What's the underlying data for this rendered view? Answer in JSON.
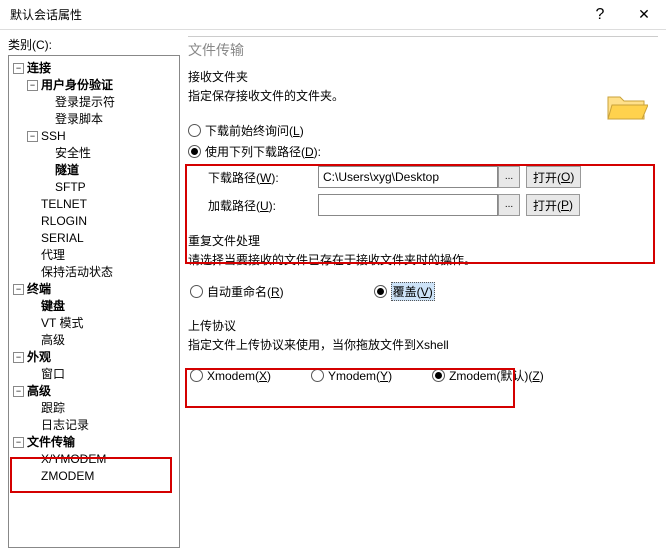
{
  "window": {
    "title": "默认会话属性",
    "help": "?",
    "close": "✕"
  },
  "left": {
    "category_label": "类别(C):"
  },
  "tree": {
    "conn": "连接",
    "auth": "用户身份验证",
    "login_prompt": "登录提示符",
    "login_script": "登录脚本",
    "ssh": "SSH",
    "security": "安全性",
    "tunnel": "隧道",
    "sftp": "SFTP",
    "telnet": "TELNET",
    "rlogin": "RLOGIN",
    "serial": "SERIAL",
    "proxy": "代理",
    "keepalive": "保持活动状态",
    "terminal": "终端",
    "keyboard": "键盘",
    "vt": "VT 模式",
    "advanced": "高级",
    "appearance": "外观",
    "window": "窗口",
    "advanced2": "高级",
    "trace": "跟踪",
    "logging": "日志记录",
    "filexfer": "文件传输",
    "xymodem": "X/YMODEM",
    "zmodem": "ZMODEM"
  },
  "panel": {
    "title": "文件传输",
    "recv_head": "接收文件夹",
    "recv_sub": "指定保存接收文件的文件夹。",
    "radio_ask_1": "下载前始终询问(",
    "radio_ask_2": "L",
    "radio_ask_3": ")",
    "radio_path_1": "使用下列下载路径(",
    "radio_path_2": "D",
    "radio_path_3": "):",
    "dl_label_1": "下载路径(",
    "dl_label_2": "W",
    "dl_label_3": "):",
    "dl_value": "C:\\Users\\xyg\\Desktop",
    "load_label_1": "加载路径(",
    "load_label_2": "U",
    "load_label_3": "):",
    "load_value": "",
    "dots": "...",
    "open1_1": "打开(",
    "open1_2": "O",
    "open1_3": ")",
    "open2_1": "打开(",
    "open2_2": "P",
    "open2_3": ")",
    "dup_head": "重复文件处理",
    "dup_sub": "请选择当要接收的文件已存在于接收文件夹时的操作。",
    "auto_1": "自动重命名(",
    "auto_2": "R",
    "auto_3": ")",
    "over_1": "覆盖(",
    "over_2": "V",
    "over_3": ")",
    "up_head": "上传协议",
    "up_sub": "指定文件上传协议来使用，当你拖放文件到Xshell",
    "xm_1": "Xmodem(",
    "xm_2": "X",
    "xm_3": ")",
    "ym_1": "Ymodem(",
    "ym_2": "Y",
    "ym_3": ")",
    "zm_1": "Zmodem(默认)(",
    "zm_2": "Z",
    "zm_3": ")"
  }
}
